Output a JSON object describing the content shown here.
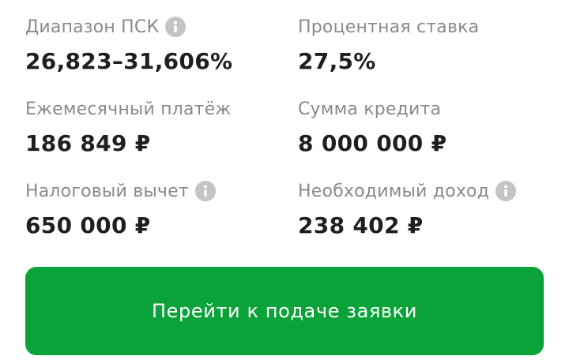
{
  "stats": [
    {
      "label": "Диапазон ПСК",
      "value": "26,823–31,606%",
      "icon": "info-icon"
    },
    {
      "label": "Процентная ставка",
      "value": "27,5%"
    },
    {
      "label": "Ежемесячный платёж",
      "value": "186 849 ₽"
    },
    {
      "label": "Сумма кредита",
      "value": "8 000 000 ₽"
    },
    {
      "label": "Налоговый вычет",
      "value": "650 000 ₽",
      "icon": "info-icon"
    },
    {
      "label": "Необходимый доход",
      "value": "238 402 ₽",
      "icon": "info-icon"
    }
  ],
  "cta": {
    "label": "Перейти к подаче заявки",
    "color": "#0aa33a"
  }
}
